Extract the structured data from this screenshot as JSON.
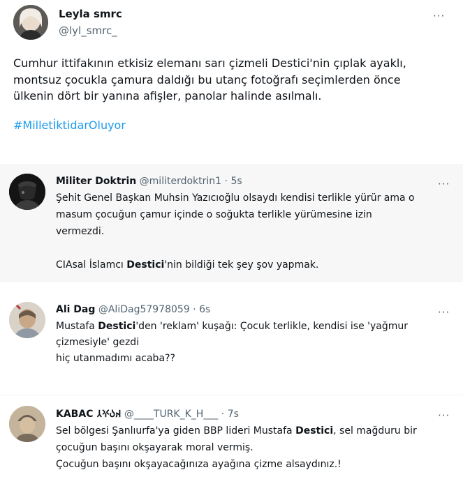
{
  "main_tweet": {
    "author_name": "Leyla smrc",
    "author_handle": "@lyl_smrc_",
    "text_lines": [
      "Cumhur ittifakının etkisiz elemanı sarı çizmeli Destici'nin çıplak ayaklı,",
      "montsuz çocukla çamura daldığı bu utanç fotoğrafı seçimlerden önce",
      "ülkenin dört bir yanına afişler, panolar halinde asılmalı."
    ],
    "hashtag": "#MilletİktidarOluyor",
    "more_icon": "···"
  },
  "replies": [
    {
      "name": "Militer Doktrin",
      "handle": "@militerdoktrin1",
      "sep": " · ",
      "time": "5s",
      "more_icon": "···",
      "lines": [
        "Şehit Genel Başkan Muhsin Yazıcıoğlu olsaydı kendisi terlikle yürür ama o",
        "masum çocuğun çamur içinde o soğukta terlikle yürümesine izin",
        "vermezdi."
      ],
      "line2_pre": "CIAsal İslamcı ",
      "line2_bold": "Destici",
      "line2_post": "'nin bildiği tek şey şov yapmak."
    },
    {
      "name": "Ali Dag",
      "handle": "@AliDag57978059",
      "sep": " · ",
      "time": "6s",
      "more_icon": "···",
      "l1_pre": "Mustafa ",
      "l1_bold": "Destici",
      "l1_post": "'den 'reklam' kuşağı: Çocuk terlikle, kendisi ise 'yağmur",
      "l2": "çizmesiyle' gezdi",
      "l3": "hiç utanmadımı acaba??"
    },
    {
      "name": "KABAC 𐰴𐰉𐰍𐰲",
      "handle": "@____TURK_K_H___",
      "sep": " · ",
      "time": "7s",
      "more_icon": "···",
      "l1_pre": "Sel bölgesi Şanlıurfa'ya giden BBP lideri Mustafa ",
      "l1_bold": "Destici",
      "l1_post": ", sel mağduru bir",
      "l2": "çocuğun başını okşayarak moral vermiş.",
      "l3": "Çocuğun başını okşayacağınıza ayağına çizme alsaydınız.!"
    }
  ]
}
